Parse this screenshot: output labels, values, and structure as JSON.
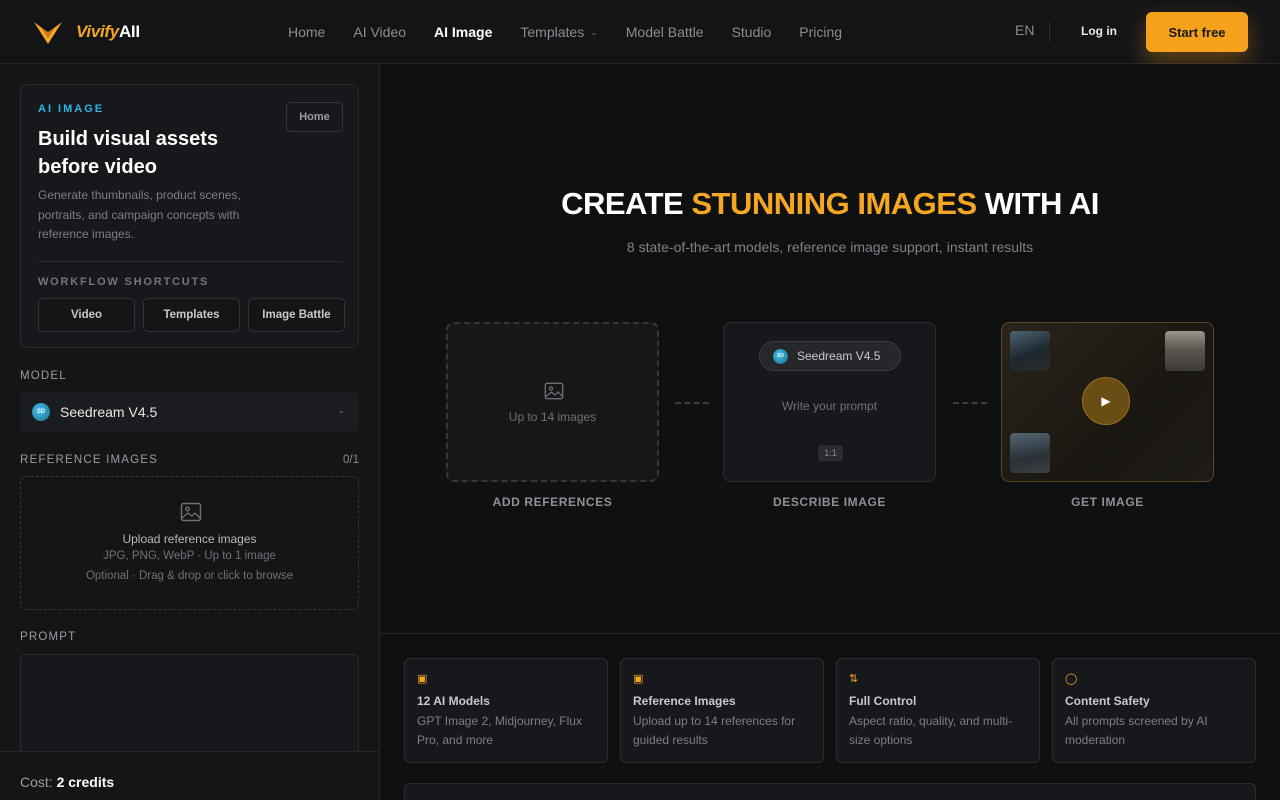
{
  "brand": {
    "part_a": "Vivify",
    "part_b": "AII"
  },
  "nav": {
    "items": [
      {
        "label": "Home"
      },
      {
        "label": "AI Video"
      },
      {
        "label": "AI Image",
        "active": true
      },
      {
        "label": "Templates",
        "has_dropdown": true
      },
      {
        "label": "Model Battle"
      },
      {
        "label": "Studio"
      },
      {
        "label": "Pricing"
      }
    ],
    "language": "EN",
    "login": "Log in",
    "cta": "Start free"
  },
  "sidebar": {
    "card": {
      "eyebrow": "AI IMAGE",
      "title": "Build visual assets before video",
      "home_button": "Home",
      "description": "Generate thumbnails, product scenes, portraits, and campaign concepts with reference images.",
      "shortcuts_label": "WORKFLOW SHORTCUTS",
      "shortcuts": [
        "Video",
        "Templates",
        "Image Battle"
      ]
    },
    "model": {
      "label": "MODEL",
      "selected": "Seedream V4.5",
      "badge": "SD"
    },
    "reference": {
      "label": "REFERENCE IMAGES",
      "count": "0/1",
      "title": "Upload reference images",
      "meta": "JPG, PNG, WebP · Up to 1 image",
      "hint": "Optional · Drag & drop or click to browse"
    },
    "prompt": {
      "label": "PROMPT"
    },
    "cost": {
      "label": "Cost:",
      "value": "2 credits"
    }
  },
  "hero": {
    "title_pre": "CREATE ",
    "title_accent": "STUNNING IMAGES",
    "title_post": " WITH AI",
    "subtitle": "8 state-of-the-art models, reference image support, instant results"
  },
  "steps": [
    {
      "label": "ADD REFERENCES",
      "text": "Up to 14 images"
    },
    {
      "label": "DESCRIBE IMAGE",
      "model": "Seedream V4.5",
      "badge": "SD",
      "placeholder": "Write your prompt",
      "ratio": "1:1"
    },
    {
      "label": "GET IMAGE"
    }
  ],
  "features": [
    {
      "icon": "image-icon",
      "title": "12 AI Models",
      "desc": "GPT Image 2, Midjourney, Flux Pro, and more"
    },
    {
      "icon": "image-icon",
      "title": "Reference Images",
      "desc": "Upload up to 14 references for guided results"
    },
    {
      "icon": "sliders-icon",
      "title": "Full Control",
      "desc": "Aspect ratio, quality, and multi-size options"
    },
    {
      "icon": "shield-icon",
      "title": "Content Safety",
      "desc": "All prompts screened by AI moderation"
    }
  ],
  "colors": {
    "accent": "#f5a623",
    "eyebrow": "#2fb4e6",
    "background": "#111214"
  }
}
